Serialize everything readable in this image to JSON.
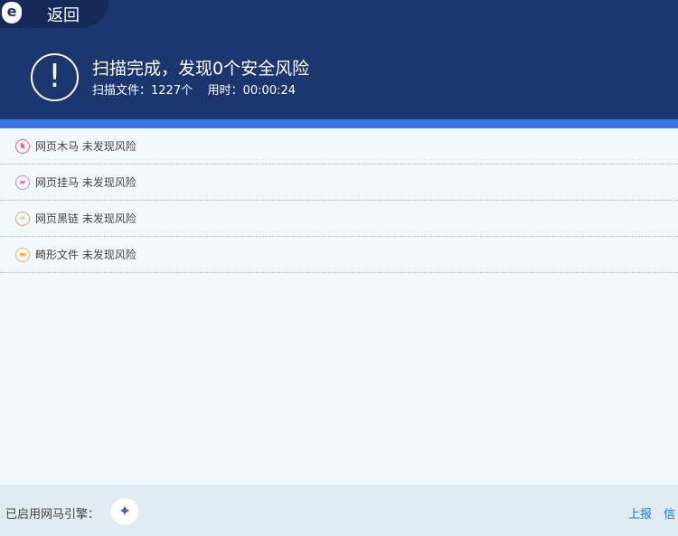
{
  "header": {
    "back_label": "返回",
    "logo_letter": "e",
    "title": "扫描完成，发现0个安全风险",
    "files_label": "扫描文件：1227个",
    "time_label": "用时：00:00:24"
  },
  "results": [
    {
      "name": "网页木马",
      "status": "未发现风险",
      "color": "#e8606e"
    },
    {
      "name": "网页挂马",
      "status": "未发现风险",
      "color": "#c58ac8"
    },
    {
      "name": "网页黑链",
      "status": "未发现风险",
      "color": "#f0a060"
    },
    {
      "name": "畸形文件",
      "status": "未发现风险",
      "color": "#f5b84a"
    }
  ],
  "footer": {
    "engine_label": "已启用网马引擎：",
    "report_link": "上报",
    "trust_link": "信"
  }
}
